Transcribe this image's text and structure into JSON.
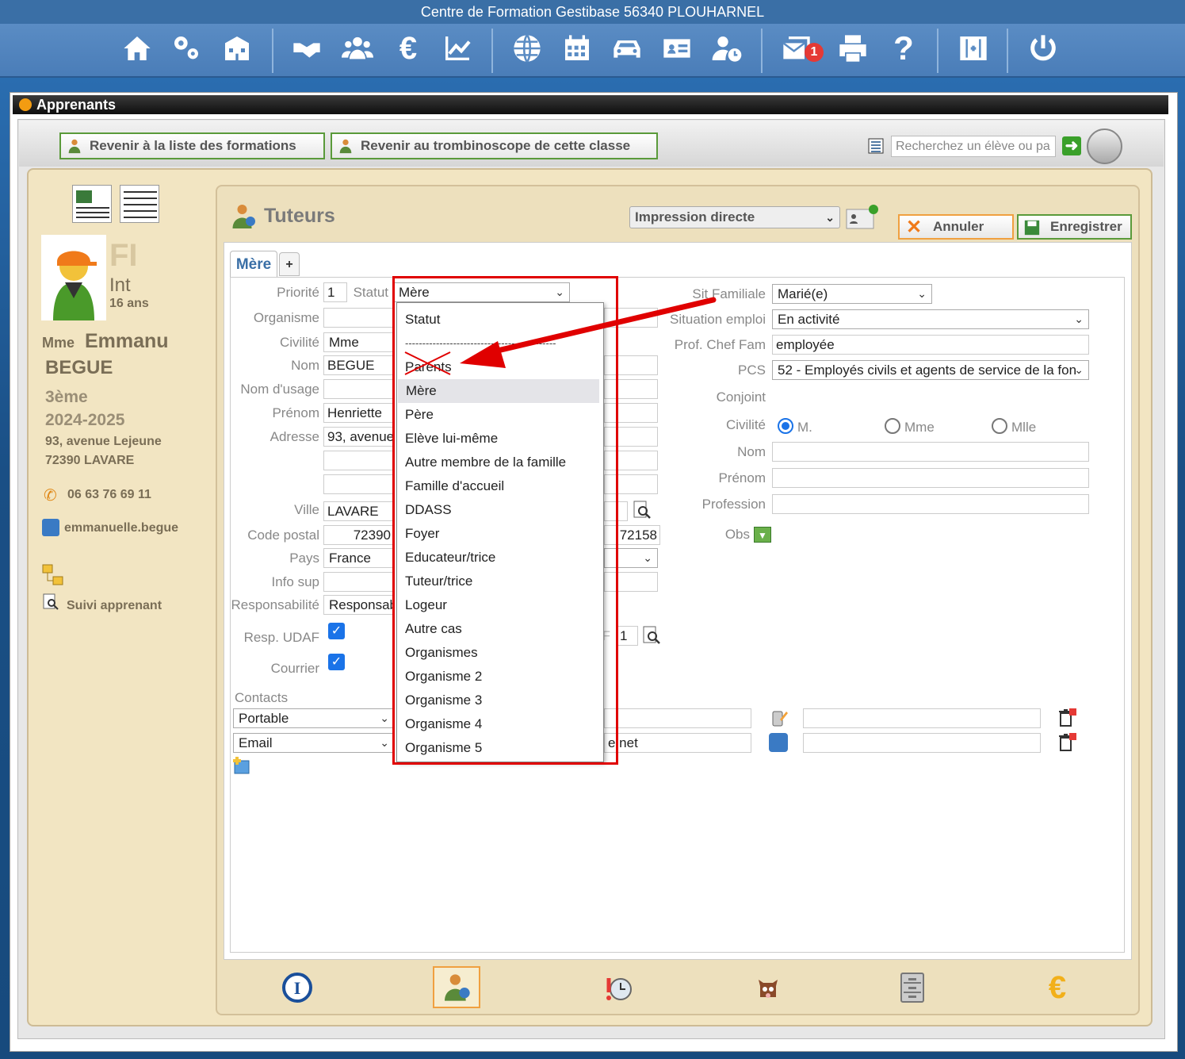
{
  "app": {
    "title": "Centre de Formation Gestibase 56340 PLOUHARNEL"
  },
  "topnav": {
    "icons": [
      "home-icon",
      "settings-icon",
      "school-icon",
      "handshake-icon",
      "users-icon",
      "euro-icon",
      "chart-icon",
      "globe-icon",
      "calendar-icon",
      "car-icon",
      "id-card-icon",
      "user-clock-icon",
      "mail-icon",
      "print-icon",
      "help-icon",
      "plus-square-icon",
      "power-icon"
    ],
    "mail_badge": "1"
  },
  "window": {
    "title": "Apprenants"
  },
  "toolbar": {
    "back_formations": "Revenir à la liste des formations",
    "back_trombinoscope": "Revenir au trombinoscope de cette classe",
    "search_placeholder": "Recherchez un élève ou pa"
  },
  "student": {
    "fi": "FI",
    "int": "Int",
    "age": "16 ans",
    "civility": "Mme",
    "firstname": "Emmanu",
    "lastname": "BEGUE",
    "class": "3ème",
    "year": "2024-2025",
    "address1": "93, avenue Lejeune",
    "address2": "72390 LAVARE",
    "phone": "06 63 76 69 11",
    "email": "emmanuelle.begue",
    "follow_link": "Suivi apprenant"
  },
  "section": {
    "title": "Tuteurs",
    "print_mode": "Impression directe",
    "cancel": "Annuler",
    "save": "Enregistrer"
  },
  "tabs": {
    "active": "Mère",
    "add": "+"
  },
  "form": {
    "priorite_label": "Priorité",
    "priorite": "1",
    "statut_label": "Statut",
    "statut": "Mère",
    "organisme_label": "Organisme",
    "civilite_label": "Civilité",
    "civilite": "Mme",
    "nom_label": "Nom",
    "nom": "BEGUE",
    "nom_usage_label": "Nom d'usage",
    "prenom_label": "Prénom",
    "prenom": "Henriette",
    "adresse_label": "Adresse",
    "adresse": "93, avenue",
    "ville_label": "Ville",
    "ville": "LAVARE",
    "cp_label": "Code postal",
    "cp": "72390",
    "cp_code": "72158",
    "pays_label": "Pays",
    "pays": "France",
    "info_sup_label": "Info sup",
    "responsabilite_label": "Responsabilité",
    "responsabilite": "Responsab",
    "resp_udaf_label": "Resp. UDAF",
    "courrier_label": "Courrier",
    "udaf_frag": "F",
    "udaf_value": "1",
    "contacts_label": "Contacts",
    "contact1_type": "Portable",
    "contact2_type": "Email",
    "contact2_value_frag": "e.net"
  },
  "right": {
    "sit_familiale_label": "Sit Familiale",
    "sit_familiale": "Marié(e)",
    "situation_emploi_label": "Situation emploi",
    "situation_emploi": "En activité",
    "prof_label": "Prof. Chef Fam",
    "prof": "employée",
    "pcs_label": "PCS",
    "pcs": "52 - Employés civils et agents de service de la fon",
    "conjoint_label": "Conjoint",
    "civilite_label": "Civilité",
    "radio_m": "M.",
    "radio_mme": "Mme",
    "radio_mlle": "Mlle",
    "nom_label": "Nom",
    "prenom_label": "Prénom",
    "profession_label": "Profession",
    "obs_label": "Obs"
  },
  "dropdown": {
    "items": [
      "Statut",
      "--------------------------------------------",
      "Parents",
      "Mère",
      "Père",
      "Elève lui-même",
      "Autre membre de la famille",
      "Famille d'accueil",
      "DDASS",
      "Foyer",
      "Educateur/trice",
      "Tuteur/trice",
      "Logeur",
      "Autre cas",
      "Organismes",
      "Organisme 2",
      "Organisme 3",
      "Organisme 4",
      "Organisme 5"
    ],
    "selected": "Mère",
    "struck": "Parents"
  },
  "colors": {
    "annotation_red": "#e00000",
    "accent_blue": "#1a73e8",
    "green_border": "#5a9a3a"
  }
}
